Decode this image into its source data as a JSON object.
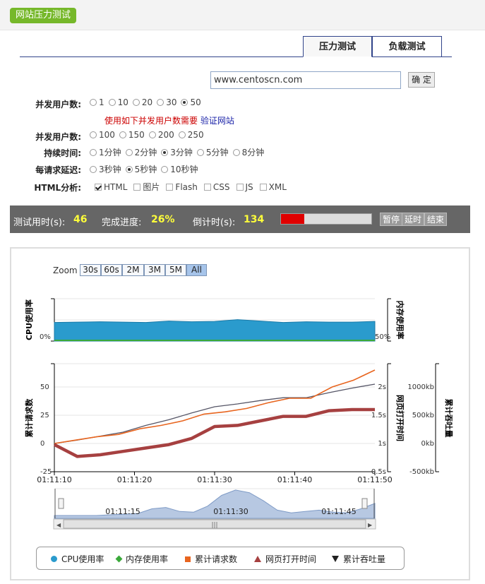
{
  "header": {
    "title": "网站压力测试"
  },
  "tabs": [
    {
      "label": "压力测试",
      "active": true
    },
    {
      "label": "负载测试",
      "active": false
    }
  ],
  "url_input": {
    "value": "www.centoscn.com"
  },
  "confirm_label": "确 定",
  "form": {
    "concurrency": {
      "label": "并发用户数:",
      "options": [
        "1",
        "10",
        "20",
        "30",
        "50"
      ],
      "selected": "50"
    },
    "notice": {
      "text": "使用如下并发用户数需要",
      "link": "验证网站"
    },
    "concurrency2": {
      "label": "并发用户数:",
      "options": [
        "100",
        "150",
        "200",
        "250"
      ]
    },
    "duration": {
      "label": "持续时间:",
      "options": [
        "1分钟",
        "2分钟",
        "3分钟",
        "5分钟",
        "8分钟"
      ],
      "selected": "3分钟"
    },
    "delay": {
      "label": "每请求延迟:",
      "options": [
        "3秒钟",
        "5秒钟",
        "10秒钟"
      ],
      "selected": "5秒钟"
    },
    "html": {
      "label": "HTML分析:",
      "options": [
        "HTML",
        "图片",
        "Flash",
        "CSS",
        "JS",
        "XML"
      ],
      "checked": [
        "HTML"
      ]
    }
  },
  "status": {
    "elapsed_label": "测试用时(s):",
    "elapsed": "46",
    "progress_label": "完成进度:",
    "progress": "26%",
    "progress_value": 0.26,
    "countdown_label": "倒计时(s):",
    "countdown": "134",
    "pause": "暂停",
    "delay_btn": "延时",
    "stop": "结束"
  },
  "zoom": {
    "label": "Zoom",
    "buttons": [
      "30s",
      "60s",
      "2M",
      "3M",
      "5M",
      "All"
    ],
    "selected": "All"
  },
  "colors": {
    "cpu": "#2a9bcd",
    "mem": "#3aa93a",
    "req": "#e8651f",
    "page": "#a64040",
    "thr": "#555566"
  },
  "chart_data": {
    "type": "line",
    "x": [
      "01:11:10",
      "01:11:12",
      "01:11:14",
      "01:11:16",
      "01:11:18",
      "01:11:20",
      "01:11:22",
      "01:11:24",
      "01:11:26",
      "01:11:28",
      "01:11:30",
      "01:11:32",
      "01:11:34",
      "01:11:36",
      "01:11:38",
      "01:11:40",
      "01:11:42",
      "01:11:44",
      "01:11:46",
      "01:11:48",
      "01:11:50"
    ],
    "x_ticks": [
      "01:11:10",
      "01:11:20",
      "01:11:30",
      "01:11:40",
      "01:11:50"
    ],
    "top_axes": {
      "left_label": "CPU使用率",
      "left_tick": "0%",
      "right_label": "内存使用率",
      "right_tick": "50%"
    },
    "bottom_axes": {
      "left_label": "累计请求数",
      "left_ticks": [
        "50",
        "25",
        "0",
        "-25"
      ],
      "right1_label": "网页打开时间",
      "right1_ticks": [
        "2s",
        "1.5s",
        "1s",
        "0.5s"
      ],
      "right2_label": "累计吞吐量",
      "right2_ticks": [
        "1000kb",
        "500kb",
        "0kb",
        "-500kb"
      ]
    },
    "series": [
      {
        "name": "CPU使用率",
        "axis": "cpu",
        "values": [
          52,
          null,
          53,
          null,
          54,
          null,
          53,
          null,
          52,
          null,
          56,
          null,
          54,
          null,
          55,
          null,
          60,
          null,
          56,
          null,
          52,
          null,
          54,
          null,
          53,
          null,
          53,
          null,
          55
        ]
      },
      {
        "name": "内存使用率",
        "axis": "cpu",
        "values": [
          0.5,
          0.5,
          0.5,
          0.5,
          0.5,
          0.5,
          0.5,
          0.5,
          0.5,
          0.5,
          0.5,
          0.5,
          0.5,
          0.5,
          0.5,
          0.5,
          0.5,
          0.5,
          0.5,
          0.5,
          0.5,
          0.5,
          0.5,
          0.5,
          0.5,
          0.5,
          0.5,
          0.5,
          0.5
        ]
      },
      {
        "name": "累计请求数",
        "axis": "req",
        "values": [
          0,
          null,
          3,
          null,
          6,
          null,
          8,
          null,
          13,
          null,
          16,
          null,
          20,
          null,
          26,
          null,
          28,
          null,
          31,
          null,
          36,
          null,
          40,
          null,
          40,
          null,
          50,
          null,
          56,
          null,
          65
        ]
      },
      {
        "name": "网页打开时间",
        "axis": "time",
        "values": [
          0.98,
          null,
          0.77,
          null,
          0.8,
          null,
          0.86,
          null,
          0.92,
          null,
          0.98,
          null,
          1.09,
          null,
          1.3,
          null,
          1.32,
          null,
          1.4,
          null,
          1.48,
          null,
          1.48,
          null,
          1.58,
          null,
          1.6,
          null,
          1.6
        ]
      },
      {
        "name": "累计吞吐量",
        "axis": "thr",
        "values": [
          0,
          null,
          60,
          null,
          130,
          null,
          200,
          null,
          320,
          null,
          420,
          null,
          540,
          null,
          650,
          null,
          700,
          null,
          760,
          null,
          810,
          null,
          810,
          null,
          900,
          null,
          980,
          null,
          1050
        ]
      }
    ],
    "navigator_ticks": [
      "01:11:15",
      "01:11:30",
      "01:11:45"
    ]
  },
  "legend": [
    {
      "name": "CPU使用率",
      "marker": "circle"
    },
    {
      "name": "内存使用率",
      "marker": "diamond"
    },
    {
      "name": "累计请求数",
      "marker": "square"
    },
    {
      "name": "网页打开时间",
      "marker": "triangle-up"
    },
    {
      "name": "累计吞吐量",
      "marker": "triangle-down"
    }
  ]
}
